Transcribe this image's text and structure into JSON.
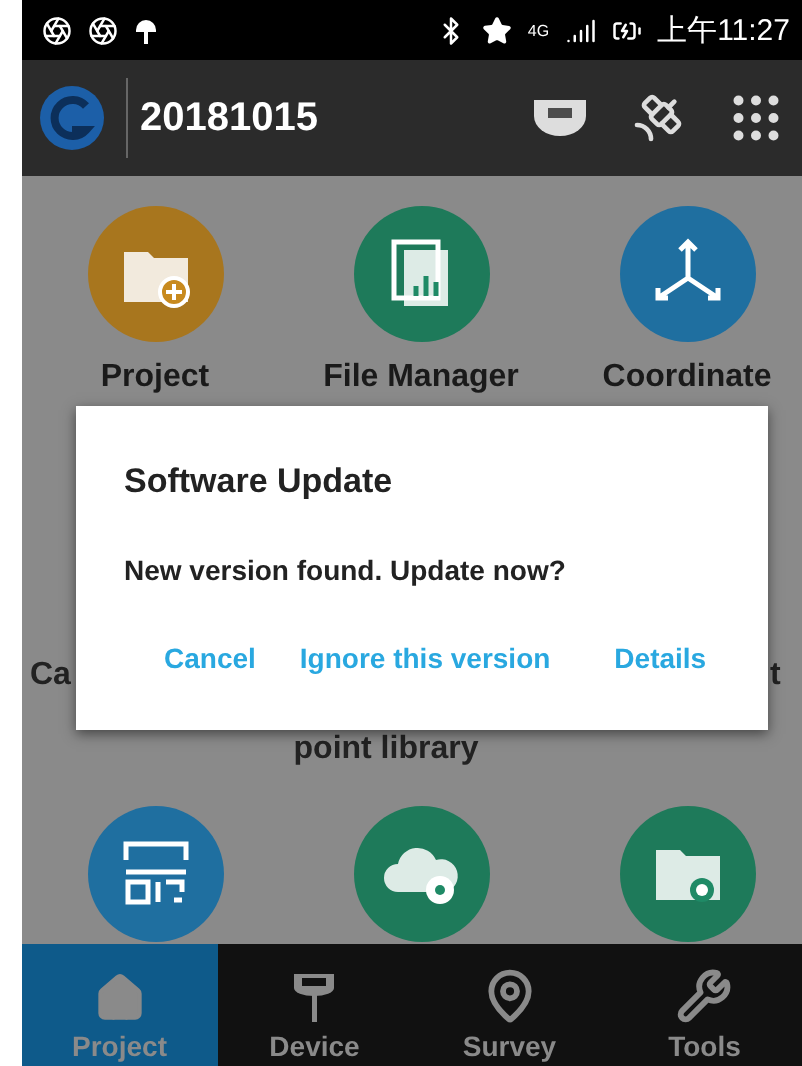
{
  "status_bar": {
    "time": "上午11:27",
    "network": "4G"
  },
  "app_bar": {
    "title": "20181015"
  },
  "grid": {
    "row_1": [
      {
        "label": "Project",
        "kind": "folder-add",
        "color": "#a8761e"
      },
      {
        "label": "File Manager",
        "kind": "file-chart",
        "color": "#1e7a5a"
      },
      {
        "label": "Coordinate",
        "kind": "axes",
        "color": "#1f6fa0"
      }
    ],
    "row_2": [
      {
        "label": "Ca"
      },
      {
        "label": "point library"
      },
      {
        "label": "t"
      }
    ],
    "row_3": [
      {
        "kind": "qr-scan",
        "color": "#1f6fa0"
      },
      {
        "kind": "cloud-gear",
        "color": "#1e7a5a"
      },
      {
        "kind": "folder-gear",
        "color": "#1e7a5a"
      }
    ]
  },
  "dialog": {
    "title": "Software Update",
    "message": "New version found. Update now?",
    "buttons": [
      "Cancel",
      "Ignore this version",
      "Details"
    ]
  },
  "bottom_nav": [
    {
      "label": "Project",
      "kind": "home",
      "selected": true
    },
    {
      "label": "Device",
      "kind": "receiver",
      "selected": false
    },
    {
      "label": "Survey",
      "kind": "pin",
      "selected": false
    },
    {
      "label": "Tools",
      "kind": "tools",
      "selected": false
    }
  ]
}
